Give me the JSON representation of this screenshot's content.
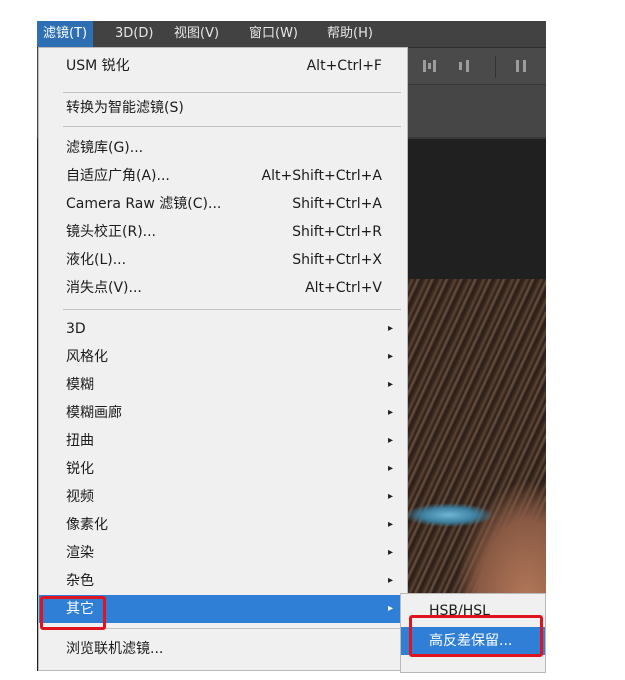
{
  "menubar": {
    "items": [
      "滤镜(T)",
      "3D(D)",
      "视图(V)",
      "窗口(W)",
      "帮助(H)"
    ]
  },
  "filter_menu": {
    "items": [
      {
        "label": "USM 锐化",
        "shortcut": "Alt+Ctrl+F"
      },
      {
        "label": "转换为智能滤镜(S)"
      },
      {
        "label": "滤镜库(G)..."
      },
      {
        "label": "自适应广角(A)...",
        "shortcut": "Alt+Shift+Ctrl+A"
      },
      {
        "label": "Camera Raw 滤镜(C)...",
        "shortcut": "Shift+Ctrl+A"
      },
      {
        "label": "镜头校正(R)...",
        "shortcut": "Shift+Ctrl+R"
      },
      {
        "label": "液化(L)...",
        "shortcut": "Shift+Ctrl+X"
      },
      {
        "label": "消失点(V)...",
        "shortcut": "Alt+Ctrl+V"
      },
      {
        "label": "3D",
        "submenu": true
      },
      {
        "label": "风格化",
        "submenu": true
      },
      {
        "label": "模糊",
        "submenu": true
      },
      {
        "label": "模糊画廊",
        "submenu": true
      },
      {
        "label": "扭曲",
        "submenu": true
      },
      {
        "label": "锐化",
        "submenu": true
      },
      {
        "label": "视频",
        "submenu": true
      },
      {
        "label": "像素化",
        "submenu": true
      },
      {
        "label": "渲染",
        "submenu": true
      },
      {
        "label": "杂色",
        "submenu": true
      },
      {
        "label": "其它",
        "submenu": true,
        "selected": true
      },
      {
        "label": "浏览联机滤镜..."
      }
    ],
    "arrow_glyph": "▸"
  },
  "submenu_other": {
    "items": [
      {
        "label": "HSB/HSL"
      },
      {
        "label": "高反差保留...",
        "selected": true
      }
    ]
  },
  "colors": {
    "selection": "#2f7fd6",
    "highlight_box": "#e0141e",
    "menu_bg": "#f0f0f0",
    "menubar_bg": "#424242"
  }
}
